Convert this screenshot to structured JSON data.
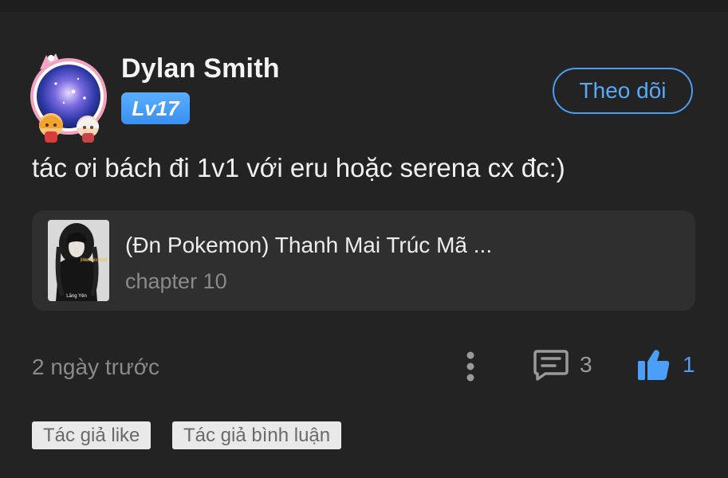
{
  "comment": {
    "author": {
      "name": "Dylan Smith",
      "level": "Lv17",
      "avatar_icon": "anime-avatar-icon"
    },
    "follow_label": "Theo dõi",
    "text": "tác ơi bách đi 1v1 với eru hoặc serena cx đc:)",
    "story": {
      "title": "(Đn Pokemon) Thanh Mai Trúc Mã ...",
      "chapter": "chapter 10",
      "cover_text": "(Đn Pokemon) Thanh mai trúc mã của Satoshi!!",
      "cover_author": "Lăng Yên"
    },
    "timestamp": "2 ngày trước",
    "more_icon": "more-vertical-icon",
    "reply_icon": "comment-bubble-icon",
    "reply_count": "3",
    "like_icon": "thumbs-up-icon",
    "like_count": "1",
    "tags": {
      "author_liked": "Tác giả like",
      "author_commented": "Tác giả bình luận"
    }
  },
  "colors": {
    "background": "#232323",
    "card": "#2f2f2f",
    "accent": "#4a9df5",
    "muted": "#8a8a8a",
    "tag_background": "#e9e9e9"
  }
}
